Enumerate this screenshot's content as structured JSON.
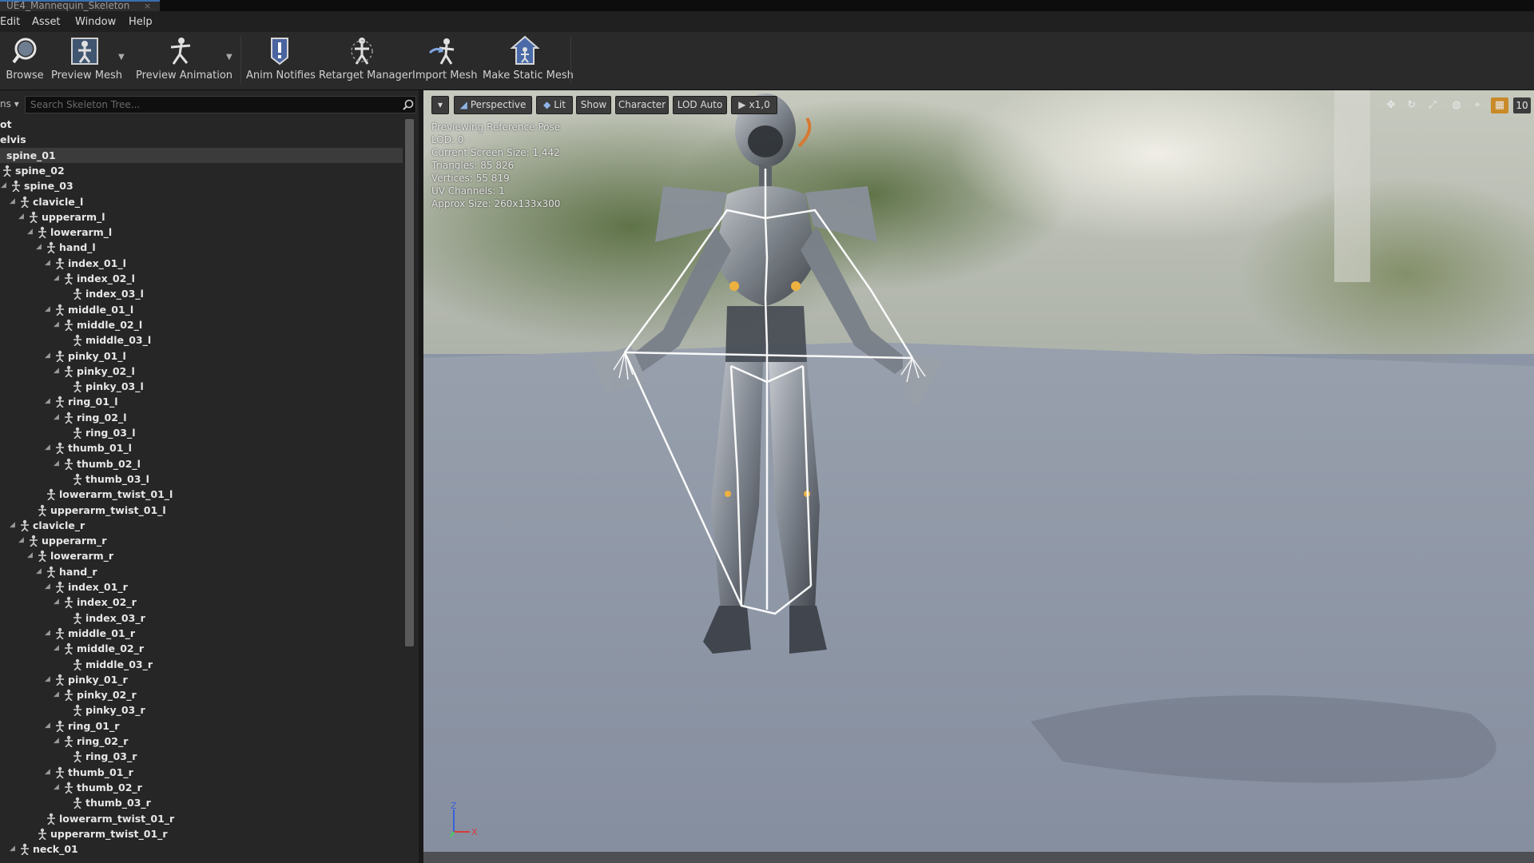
{
  "window": {
    "tab_title": "UE4_Mannequin_Skeleton",
    "tab_close": "×"
  },
  "menu": {
    "items": [
      "Edit",
      "Asset",
      "Window",
      "Help"
    ]
  },
  "toolbar": {
    "browse": "Browse",
    "preview_mesh": "Preview Mesh",
    "preview_animation": "Preview Animation",
    "anim_notifies": "Anim Notifies",
    "retarget_manager": "Retarget Manager",
    "import_mesh": "Import Mesh",
    "make_static_mesh": "Make Static Mesh"
  },
  "skeleton_tree": {
    "filter_label": "ns",
    "search_placeholder": "Search Skeleton Tree...",
    "rows": [
      {
        "name": "ot",
        "depth": -4,
        "expander": ""
      },
      {
        "name": "elvis",
        "depth": -4,
        "expander": ""
      },
      {
        "name": "spine_01",
        "depth": -3,
        "expander": "",
        "selected": true
      },
      {
        "name": "spine_02",
        "depth": -2,
        "expander": "",
        "bone": true
      },
      {
        "name": "spine_03",
        "depth": -1,
        "expander": "◢",
        "bone": true
      },
      {
        "name": "clavicle_l",
        "depth": 0,
        "expander": "◢",
        "bone": true
      },
      {
        "name": "upperarm_l",
        "depth": 1,
        "expander": "◢",
        "bone": true
      },
      {
        "name": "lowerarm_l",
        "depth": 2,
        "expander": "◢",
        "bone": true
      },
      {
        "name": "hand_l",
        "depth": 3,
        "expander": "◢",
        "bone": true
      },
      {
        "name": "index_01_l",
        "depth": 4,
        "expander": "◢",
        "bone": true
      },
      {
        "name": "index_02_l",
        "depth": 5,
        "expander": "◢",
        "bone": true
      },
      {
        "name": "index_03_l",
        "depth": 6,
        "expander": "",
        "bone": true
      },
      {
        "name": "middle_01_l",
        "depth": 4,
        "expander": "◢",
        "bone": true
      },
      {
        "name": "middle_02_l",
        "depth": 5,
        "expander": "◢",
        "bone": true
      },
      {
        "name": "middle_03_l",
        "depth": 6,
        "expander": "",
        "bone": true
      },
      {
        "name": "pinky_01_l",
        "depth": 4,
        "expander": "◢",
        "bone": true
      },
      {
        "name": "pinky_02_l",
        "depth": 5,
        "expander": "◢",
        "bone": true
      },
      {
        "name": "pinky_03_l",
        "depth": 6,
        "expander": "",
        "bone": true
      },
      {
        "name": "ring_01_l",
        "depth": 4,
        "expander": "◢",
        "bone": true
      },
      {
        "name": "ring_02_l",
        "depth": 5,
        "expander": "◢",
        "bone": true
      },
      {
        "name": "ring_03_l",
        "depth": 6,
        "expander": "",
        "bone": true
      },
      {
        "name": "thumb_01_l",
        "depth": 4,
        "expander": "◢",
        "bone": true
      },
      {
        "name": "thumb_02_l",
        "depth": 5,
        "expander": "◢",
        "bone": true
      },
      {
        "name": "thumb_03_l",
        "depth": 6,
        "expander": "",
        "bone": true
      },
      {
        "name": "lowerarm_twist_01_l",
        "depth": 3,
        "expander": "",
        "bone": true
      },
      {
        "name": "upperarm_twist_01_l",
        "depth": 2,
        "expander": "",
        "bone": true
      },
      {
        "name": "clavicle_r",
        "depth": 0,
        "expander": "◢",
        "bone": true
      },
      {
        "name": "upperarm_r",
        "depth": 1,
        "expander": "◢",
        "bone": true
      },
      {
        "name": "lowerarm_r",
        "depth": 2,
        "expander": "◢",
        "bone": true
      },
      {
        "name": "hand_r",
        "depth": 3,
        "expander": "◢",
        "bone": true
      },
      {
        "name": "index_01_r",
        "depth": 4,
        "expander": "◢",
        "bone": true
      },
      {
        "name": "index_02_r",
        "depth": 5,
        "expander": "◢",
        "bone": true
      },
      {
        "name": "index_03_r",
        "depth": 6,
        "expander": "",
        "bone": true
      },
      {
        "name": "middle_01_r",
        "depth": 4,
        "expander": "◢",
        "bone": true
      },
      {
        "name": "middle_02_r",
        "depth": 5,
        "expander": "◢",
        "bone": true
      },
      {
        "name": "middle_03_r",
        "depth": 6,
        "expander": "",
        "bone": true
      },
      {
        "name": "pinky_01_r",
        "depth": 4,
        "expander": "◢",
        "bone": true
      },
      {
        "name": "pinky_02_r",
        "depth": 5,
        "expander": "◢",
        "bone": true
      },
      {
        "name": "pinky_03_r",
        "depth": 6,
        "expander": "",
        "bone": true
      },
      {
        "name": "ring_01_r",
        "depth": 4,
        "expander": "◢",
        "bone": true
      },
      {
        "name": "ring_02_r",
        "depth": 5,
        "expander": "◢",
        "bone": true
      },
      {
        "name": "ring_03_r",
        "depth": 6,
        "expander": "",
        "bone": true
      },
      {
        "name": "thumb_01_r",
        "depth": 4,
        "expander": "◢",
        "bone": true
      },
      {
        "name": "thumb_02_r",
        "depth": 5,
        "expander": "◢",
        "bone": true
      },
      {
        "name": "thumb_03_r",
        "depth": 6,
        "expander": "",
        "bone": true
      },
      {
        "name": "lowerarm_twist_01_r",
        "depth": 3,
        "expander": "",
        "bone": true
      },
      {
        "name": "upperarm_twist_01_r",
        "depth": 2,
        "expander": "",
        "bone": true
      },
      {
        "name": "neck_01",
        "depth": 0,
        "expander": "◢",
        "bone": true
      }
    ]
  },
  "viewport": {
    "menu_arrow": "▾",
    "perspective": "Perspective",
    "lit": "Lit",
    "show": "Show",
    "character": "Character",
    "lod": "LOD Auto",
    "speed": "x1,0",
    "corner_value": "10",
    "stats": {
      "previewing": "Previewing Reference Pose",
      "lod": "LOD: 0",
      "screen_size": "Current Screen Size: 1,442",
      "triangles": "Triangles: 85 826",
      "vertices": "Vertices: 55 819",
      "uv_channels": "UV Channels: 1",
      "approx_size": "Approx Size: 260x133x300"
    },
    "axis": {
      "z": "Z",
      "x": "X"
    }
  },
  "colors": {
    "accent": "#3a6fb0",
    "viewport_floor": "#8c95a6",
    "panel": "#262626"
  }
}
